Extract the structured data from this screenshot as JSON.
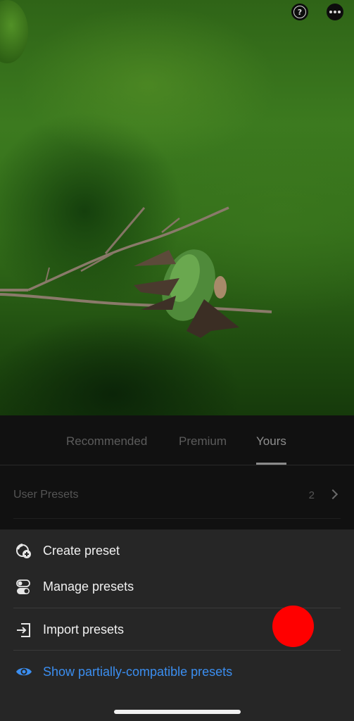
{
  "toolbar": {
    "help_icon": "help-circle-icon",
    "more_icon": "more-options-icon"
  },
  "photo": {
    "subject": "hummingbird-on-branch-photo"
  },
  "tabs": [
    {
      "label": "Recommended",
      "active": false
    },
    {
      "label": "Premium",
      "active": false
    },
    {
      "label": "Yours",
      "active": true
    }
  ],
  "user_presets": {
    "label": "User Presets",
    "count": "2"
  },
  "menu": {
    "create": "Create preset",
    "manage": "Manage presets",
    "import": "Import presets",
    "show_partial": "Show partially-compatible presets"
  },
  "colors": {
    "accent_link": "#3b8ef0",
    "tap_indicator": "#ff0000",
    "sheet_background": "#262626"
  }
}
